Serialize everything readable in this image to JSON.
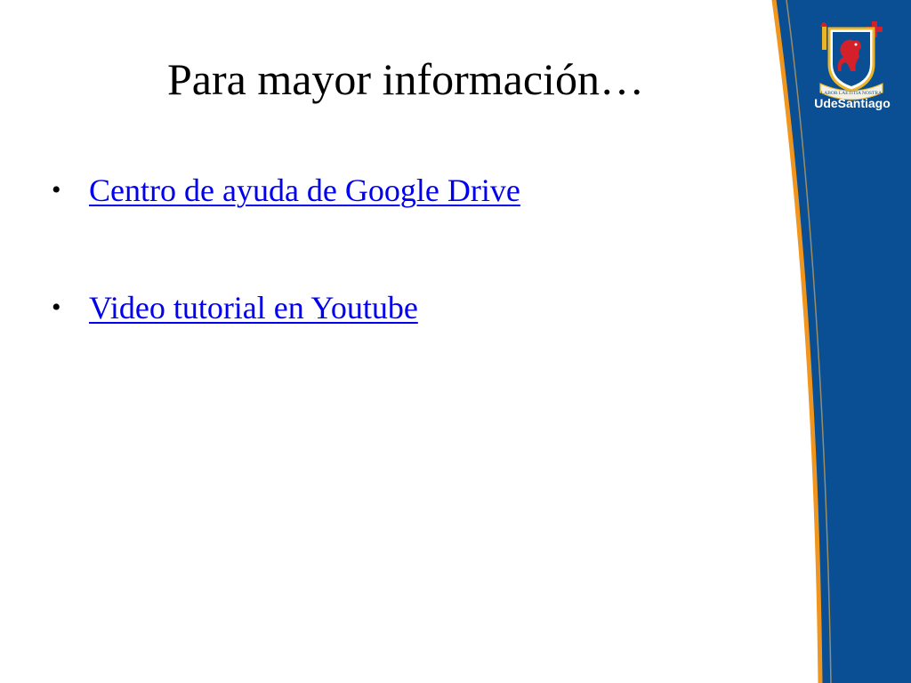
{
  "slide": {
    "title": "Para mayor información…",
    "bullets": [
      {
        "label": "Centro de ayuda de Google Drive",
        "bullet": "•"
      },
      {
        "label": "Video tutorial en Youtube",
        "bullet": "•"
      }
    ]
  },
  "logo": {
    "brand_text": "UdeSantiago",
    "icon": "university-crest-icon",
    "motto": "LABOR LAETITIA NOSTRA"
  },
  "colors": {
    "band_blue": "#0a4f94",
    "band_orange": "#f0961e",
    "link": "#0000ee",
    "crest_red": "#d4202a",
    "crest_gold": "#e9b52a"
  }
}
